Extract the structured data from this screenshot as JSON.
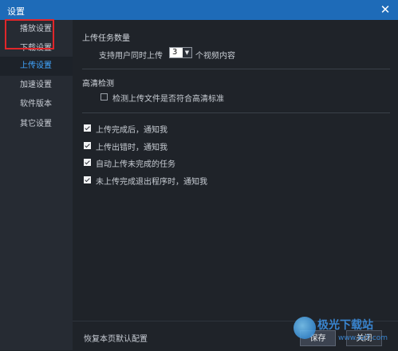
{
  "window": {
    "title": "设置",
    "close_glyph": "✕"
  },
  "sidebar": {
    "items": [
      {
        "label": "播放设置"
      },
      {
        "label": "下载设置"
      },
      {
        "label": "上传设置"
      },
      {
        "label": "加速设置"
      },
      {
        "label": "软件版本"
      },
      {
        "label": "其它设置"
      }
    ],
    "active_index": 2
  },
  "upload_count": {
    "section_title": "上传任务数量",
    "prefix": "支持用户同时上传",
    "selected_value": "3",
    "suffix": "个视频内容"
  },
  "hd_check": {
    "section_title": "高清检测",
    "option_label": "检测上传文件是否符合高清标准",
    "checked": false
  },
  "notifications": {
    "options": [
      {
        "label": "上传完成后，通知我",
        "checked": true
      },
      {
        "label": "上传出错时，通知我",
        "checked": true
      },
      {
        "label": "自动上传未完成的任务",
        "checked": true
      },
      {
        "label": "未上传完成退出程序时，通知我",
        "checked": true
      }
    ]
  },
  "footer": {
    "restore_label": "恢复本页默认配置",
    "save_label": "保存",
    "close_label": "关闭"
  },
  "watermark": {
    "brand": "极光下载站",
    "url": "www.xz7.com"
  },
  "colors": {
    "titlebar": "#1e6bb8",
    "accent": "#41a6ff",
    "annotation": "#e0262a"
  }
}
